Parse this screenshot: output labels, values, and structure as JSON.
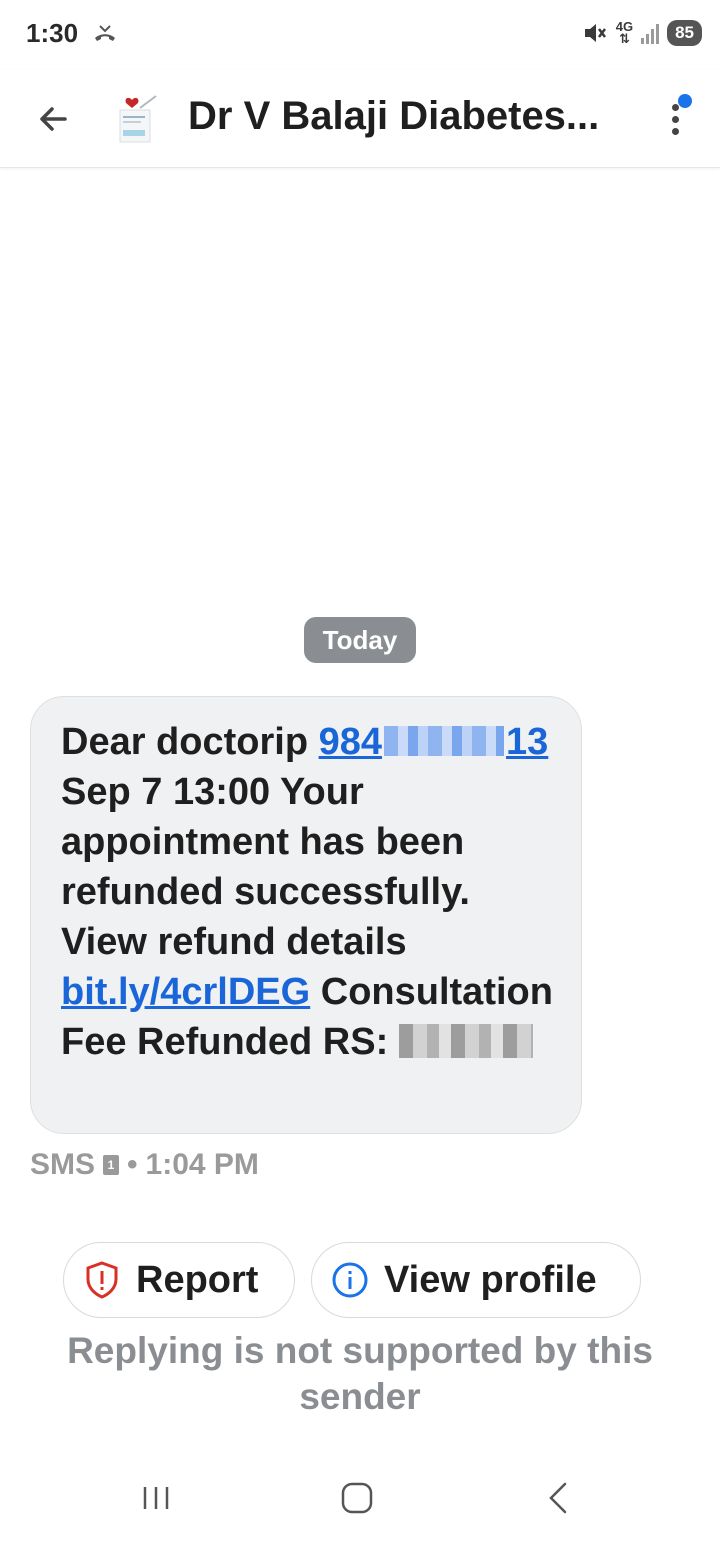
{
  "status_bar": {
    "time": "1:30",
    "network": "4G",
    "battery": "85",
    "icons": [
      "missed-call-icon",
      "mute-icon",
      "signal-icon",
      "battery-icon"
    ]
  },
  "app_bar": {
    "sender_name": "Dr V Balaji Diabetes...",
    "icons": [
      "back-arrow-icon",
      "sender-logo",
      "more-options-icon"
    ],
    "notification_dot_color": "#1a73e8"
  },
  "date_divider": "Today",
  "message": {
    "text_1": "Dear doctorip ",
    "phone_prefix": "984",
    "phone_suffix": "13",
    "text_2": " Sep 7 13:00 Your appointment has been refunded successfully. View refund details ",
    "link": "bit.ly/4crlDEG",
    "text_3": " Consultation Fee Refunded RS: ",
    "link_color": "#1a66d8"
  },
  "meta": {
    "channel": "SMS",
    "sim": "1",
    "separator": "•",
    "time": "1:04 PM"
  },
  "actions": {
    "report_label": "Report",
    "view_profile_label": "View profile",
    "report_icon_color": "#d93025",
    "profile_icon_color": "#1a73e8"
  },
  "reply_note": "Replying is not supported by this sender",
  "nav_bar": {
    "icons": [
      "recent-apps-icon",
      "home-icon",
      "back-nav-icon"
    ]
  }
}
